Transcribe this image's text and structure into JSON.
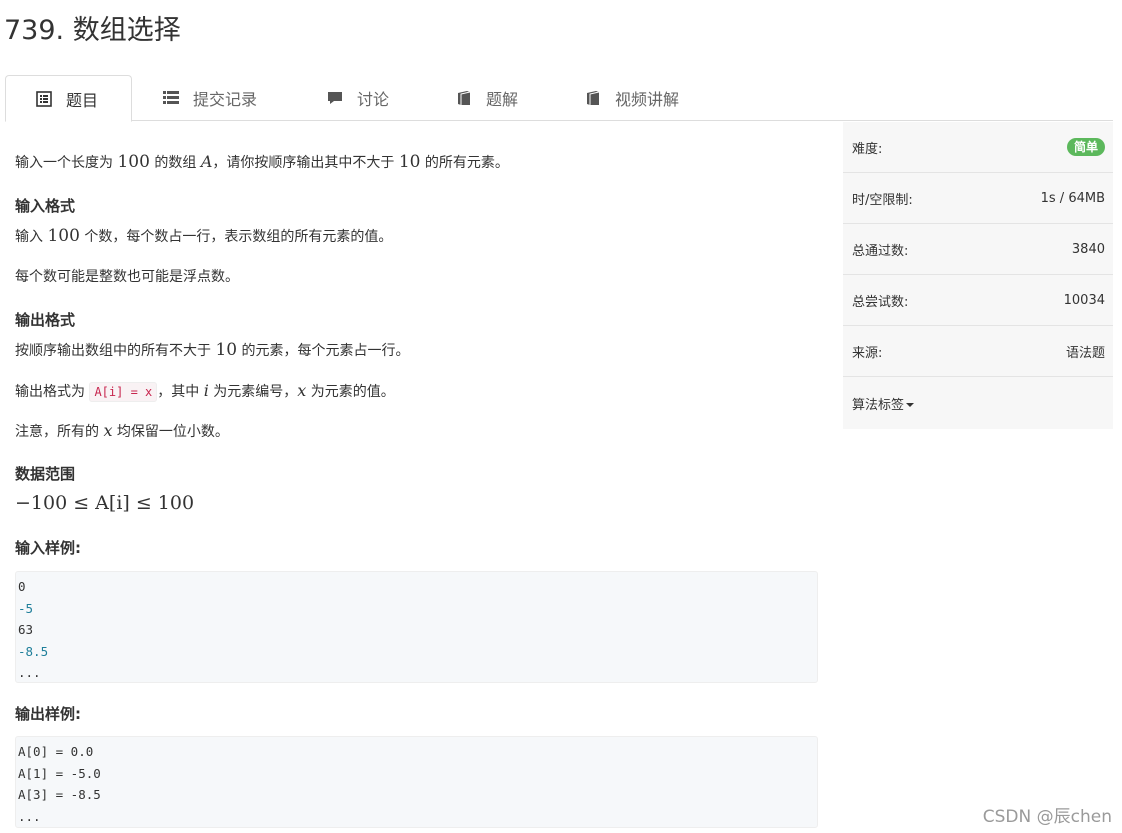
{
  "title": "739. 数组选择",
  "tabs": [
    {
      "label": "题目",
      "icon": "list-alt-icon"
    },
    {
      "label": "提交记录",
      "icon": "list-icon"
    },
    {
      "label": "讨论",
      "icon": "comment-icon"
    },
    {
      "label": "题解",
      "icon": "book-icon"
    },
    {
      "label": "视频讲解",
      "icon": "book-icon"
    }
  ],
  "problem": {
    "desc_1": "输入一个长度为 ",
    "desc_n": "100",
    "desc_2": " 的数组 ",
    "desc_a": "A",
    "desc_3": "，请你按顺序输出其中不大于 ",
    "desc_10": "10",
    "desc_4": " 的所有元素。",
    "input_title": "输入格式",
    "input_1a": "输入 ",
    "input_1n": "100",
    "input_1b": " 个数，每个数占一行，表示数组的所有元素的值。",
    "input_2": "每个数可能是整数也可能是浮点数。",
    "output_title": "输出格式",
    "output_1a": "按顺序输出数组中的所有不大于 ",
    "output_1n": "10",
    "output_1b": " 的元素，每个元素占一行。",
    "output_2a": "输出格式为 ",
    "output_2code": "A[i] = x",
    "output_2b": "，其中 ",
    "output_2i": "i",
    "output_2c": " 为元素编号，",
    "output_2x": "x",
    "output_2d": " 为元素的值。",
    "output_3a": "注意，所有的 ",
    "output_3x": "x",
    "output_3b": " 均保留一位小数。",
    "range_title": "数据范围",
    "range": "−100 ≤ A[i] ≤ 100",
    "sample_in_title": "输入样例:",
    "sample_in": [
      "0",
      "-5",
      "63",
      "-8.5",
      "..."
    ],
    "sample_out_title": "输出样例:",
    "sample_out": [
      "A[0] = 0.0",
      "A[1] = -5.0",
      "A[3] = -8.5",
      "..."
    ]
  },
  "sidebar": {
    "difficulty_label": "难度:",
    "difficulty_value": "简单",
    "limit_label": "时/空限制:",
    "limit_value": "1s / 64MB",
    "passed_label": "总通过数:",
    "passed_value": "3840",
    "tried_label": "总尝试数:",
    "tried_value": "10034",
    "source_label": "来源:",
    "source_value": "语法题",
    "tags_label": "算法标签"
  },
  "colors": {
    "badge": "#5cb85c",
    "code_inline": "#c7254e",
    "number": "#1f7f9a"
  },
  "watermark": "CSDN @辰chen"
}
